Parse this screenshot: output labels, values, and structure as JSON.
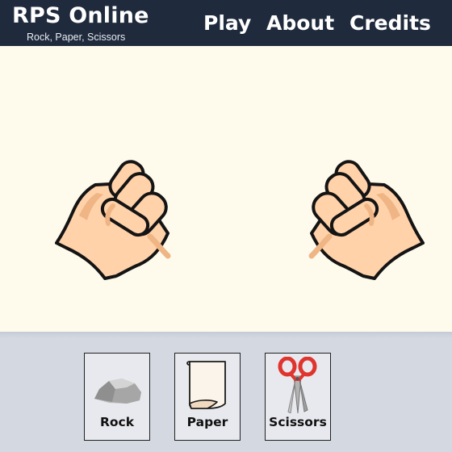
{
  "app": {
    "title": "RPS Online",
    "subtitle": "Rock, Paper, Scissors"
  },
  "nav": {
    "play": "Play",
    "about": "About",
    "credits": "Credits"
  },
  "arena": {
    "left_hand": "fist-icon",
    "right_hand": "fist-icon"
  },
  "choices": [
    {
      "label": "Rock",
      "icon": "rock-icon"
    },
    {
      "label": "Paper",
      "icon": "paper-icon"
    },
    {
      "label": "Scissors",
      "icon": "scissors-icon"
    }
  ],
  "colors": {
    "header_bg": "#1f2a3c",
    "arena_bg": "#fffbec",
    "panel_bg": "#d3d8e1",
    "button_bg": "#e8e9ee",
    "skin": "#ffd2aa",
    "skin_shadow": "#f0b585",
    "scissors_handle": "#e0342e"
  }
}
